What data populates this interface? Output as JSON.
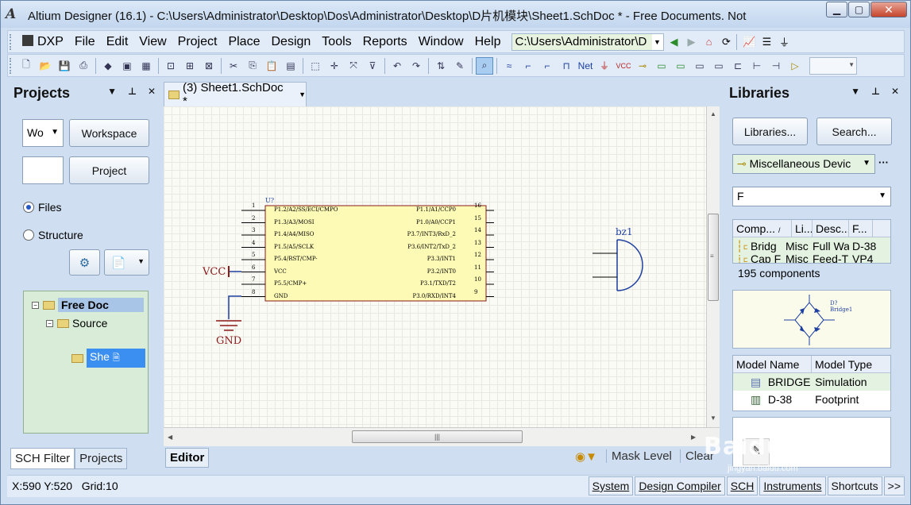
{
  "window": {
    "title": "Altium Designer (16.1) - C:\\Users\\Administrator\\Desktop\\Dos\\Administrator\\Desktop\\D片机模块\\Sheet1.SchDoc * - Free Documents. Not",
    "app_icon": "AD"
  },
  "menu": {
    "items": [
      "DXP",
      "File",
      "Edit",
      "View",
      "Project",
      "Place",
      "Design",
      "Tools",
      "Reports",
      "Window",
      "Help"
    ],
    "path": "C:\\Users\\Administrator\\D"
  },
  "projects_panel": {
    "title": "Projects",
    "combo": "Wo",
    "workspace_button": "Workspace",
    "project_button": "Project",
    "radio_files": "Files",
    "radio_structure": "Structure",
    "tree": {
      "root": "Free Doc",
      "source": "Source",
      "sheet": "She"
    },
    "tabs": [
      "SCH Filter",
      "Projects"
    ]
  },
  "document": {
    "tab_label": "(3) Sheet1.SchDoc *",
    "editor_tab": "Editor",
    "mask_level": "Mask Level",
    "clear": "Clear"
  },
  "schematic": {
    "designator": "U?",
    "left_pins": [
      {
        "num": "1",
        "name": "P1.2/A2/SS/ECI/CMPO"
      },
      {
        "num": "2",
        "name": "P1.3/A3/MOSI"
      },
      {
        "num": "3",
        "name": "P1.4/A4/MISO"
      },
      {
        "num": "4",
        "name": "P1.5/A5/SCLK"
      },
      {
        "num": "5",
        "name": "P5.4/RST/CMP-"
      },
      {
        "num": "6",
        "name": "VCC"
      },
      {
        "num": "7",
        "name": "P5.5/CMP+"
      },
      {
        "num": "8",
        "name": "GND"
      }
    ],
    "right_pins": [
      {
        "num": "16",
        "name": "P1.1/A1/CCP0"
      },
      {
        "num": "15",
        "name": "P1.0/A0/CCP1"
      },
      {
        "num": "14",
        "name": "P3.7/INT3/RxD_2"
      },
      {
        "num": "13",
        "name": "P3.6/INT2/TxD_2"
      },
      {
        "num": "12",
        "name": "P3.3/INT1"
      },
      {
        "num": "11",
        "name": "P3.2/INT0"
      },
      {
        "num": "10",
        "name": "P3.1/TXD/T2"
      },
      {
        "num": "9",
        "name": "P3.0/RXD/INT4"
      }
    ],
    "vcc_label": "VCC",
    "gnd_label": "GND",
    "buzzer_label": "bz1"
  },
  "libraries_panel": {
    "title": "Libraries",
    "libraries_button": "Libraries...",
    "search_button": "Search...",
    "library_combo": "Miscellaneous Devic",
    "filter_value": "F",
    "table_headers": [
      "Comp...",
      "Li...",
      "Desc...",
      "F..."
    ],
    "rows": [
      [
        "Bridg",
        "Misc",
        "Full Wa",
        "D-38"
      ],
      [
        "Cap F",
        "Misc",
        "Feed-Th",
        "VP4"
      ]
    ],
    "component_count": "195 components",
    "preview_designator": "D?",
    "preview_name": "Bridge1",
    "model_headers": [
      "Model Name",
      "Model Type"
    ],
    "models": [
      {
        "name": "BRIDGE",
        "type": "Simulation"
      },
      {
        "name": "D-38",
        "type": "Footprint"
      }
    ]
  },
  "status": {
    "coords": "X:590 Y:520",
    "grid": "Grid:10",
    "buttons": [
      "System",
      "Design Compiler",
      "SCH",
      "Instruments",
      "Shortcuts",
      ">>"
    ]
  },
  "watermark": {
    "main": "Baidu 经验",
    "sub": "jingyan.baidu.com"
  },
  "colors": {
    "wire": "#1d3fa0",
    "power": "#8b1a1a",
    "chip_fill": "#fdfab6",
    "selected": "#3a8ff0"
  }
}
